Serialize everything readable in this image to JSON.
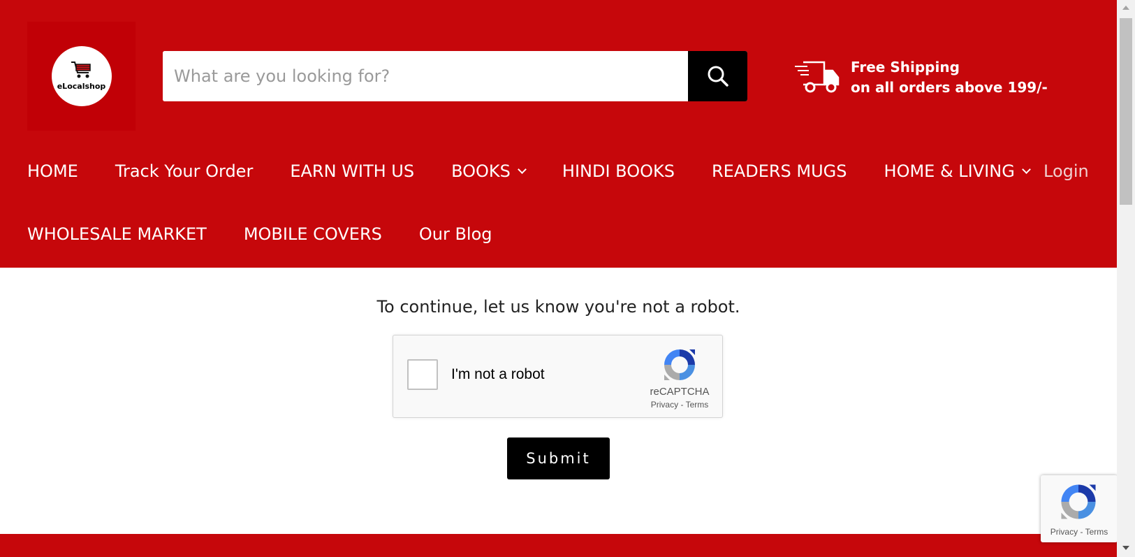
{
  "colors": {
    "brand_red": "#c6070b",
    "search_button": "#000000",
    "submit_button": "#000000"
  },
  "logo": {
    "text": "eLocalshop",
    "icon": "shopping-cart-icon"
  },
  "search": {
    "placeholder": "What are you looking for?",
    "button_icon": "search-icon"
  },
  "shipping": {
    "icon": "truck-icon",
    "line1": "Free Shipping",
    "line2": "on all orders above 199/-"
  },
  "nav": {
    "row1": [
      {
        "label": "HOME",
        "has_dropdown": false
      },
      {
        "label": "Track Your Order",
        "has_dropdown": false
      },
      {
        "label": "EARN WITH US",
        "has_dropdown": false
      },
      {
        "label": "BOOKS",
        "has_dropdown": true
      },
      {
        "label": "HINDI BOOKS",
        "has_dropdown": false
      },
      {
        "label": "READERS MUGS",
        "has_dropdown": false
      },
      {
        "label": "HOME & LIVING",
        "has_dropdown": true
      }
    ],
    "row2": [
      {
        "label": "WHOLESALE MARKET",
        "has_dropdown": false
      },
      {
        "label": "MOBILE COVERS",
        "has_dropdown": false
      },
      {
        "label": "Our Blog",
        "has_dropdown": false
      }
    ],
    "login": "Login"
  },
  "main": {
    "message": "To continue, let us know you're not a robot.",
    "captcha": {
      "checkbox_label": "I'm not a robot",
      "brand": "reCAPTCHA",
      "privacy": "Privacy",
      "separator": "-",
      "terms": "Terms"
    },
    "submit_label": "Submit"
  },
  "badge": {
    "privacy": "Privacy",
    "separator": "-",
    "terms": "Terms"
  }
}
